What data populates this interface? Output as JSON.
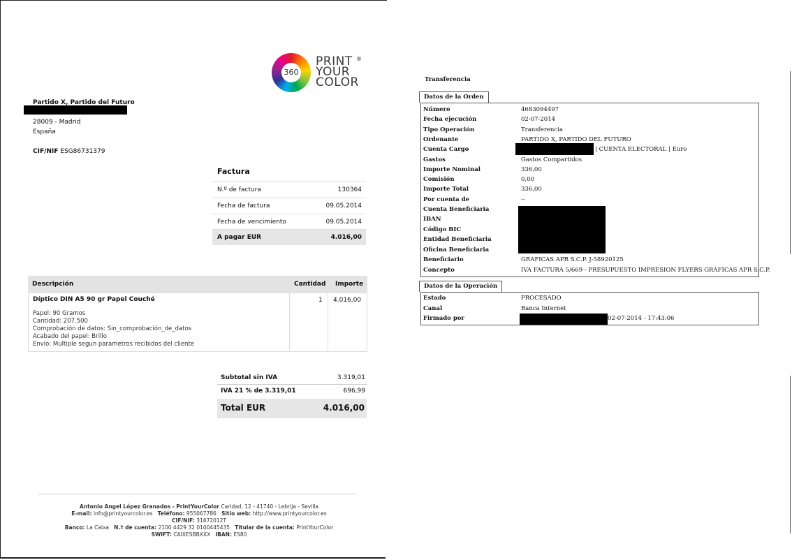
{
  "logo": {
    "number": "360",
    "line1": "PRINT",
    "line2": "YOUR",
    "line3": "COLOR",
    "reg": "®"
  },
  "client": {
    "name": "Partido X, Partido del Futuro",
    "postal": "28009 - Madrid",
    "country": "España",
    "cif_label": "CIF/NIF",
    "cif_value": "ESG86731379"
  },
  "invoice": {
    "title": "Factura",
    "rows": [
      {
        "label": "N.º de factura",
        "value": "130364"
      },
      {
        "label": "Fecha de factura",
        "value": "09.05.2014"
      },
      {
        "label": "Fecha de vencimiento",
        "value": "09.05.2014"
      }
    ],
    "pay_label": "A pagar EUR",
    "pay_value": "4.016,00"
  },
  "items": {
    "headers": {
      "description": "Descripción",
      "quantity": "Cantidad",
      "amount": "Importe"
    },
    "product": "Díptico DIN A5 90 gr Papel Couché",
    "quantity": "1",
    "amount": "4.016,00",
    "details": [
      "Papel: 90 Gramos",
      "Cantidad: 207.500",
      "Comprobación de datos: Sin_comprobación_de_datos",
      "Acabado del papel: Brillo",
      "Envío: Multiple segun parametros recibidos del cliente"
    ]
  },
  "totals": {
    "subtotal_label": "Subtotal sin IVA",
    "subtotal_value": "3.319,01",
    "iva_label": "IVA 21 % de 3.319,01",
    "iva_value": "696,99",
    "total_label": "Total EUR",
    "total_value": "4.016,00"
  },
  "footer": {
    "line1_bold": "Antonio Angel López Granados - PrintYourColor",
    "line1_rest": "Caridad, 12 - 41740 - Lebrija - Sevilla",
    "email_label": "E-mail:",
    "email": "info@printyourcolor.es",
    "phone_label": "Teléfono:",
    "phone": "955067786",
    "web_label": "Sitio web:",
    "web": "http://www.printyourcolor.es",
    "cif_label": "CIF/NIF:",
    "cif": "31672012T",
    "bank_label": "Banco:",
    "bank": "La Caixa",
    "account_label": "N.º de cuenta:",
    "account": "2100 4429 32 0100445435",
    "holder_label": "Titular de la cuenta:",
    "holder": "PrintYourColor",
    "swift_label": "SWIFT:",
    "swift": "CAIXESBBXXX",
    "iban_label": "IBAN:",
    "iban": "ES80"
  },
  "transfer": {
    "title": "Transferencia",
    "order_tab": "Datos de la Orden",
    "order_rows": [
      {
        "key": "Número",
        "value": "4683094497"
      },
      {
        "key": "Fecha ejecución",
        "value": "02-07-2014"
      },
      {
        "key": "Tipo Operación",
        "value": "Transferencia"
      },
      {
        "key": "Ordenante",
        "value": "PARTIDO X, PARTIDO DEL FUTURO"
      },
      {
        "key": "Cuenta Cargo",
        "value": "| CUENTA ELECTORAL | Euro"
      },
      {
        "key": "Gastos",
        "value": "Gastos Compartidos"
      },
      {
        "key": "Importe Nominal",
        "value": "336,00"
      },
      {
        "key": "Comisión",
        "value": "0,00"
      },
      {
        "key": "Importe Total",
        "value": "336,00"
      },
      {
        "key": "Por cuenta de",
        "value": "--"
      },
      {
        "key": "Cuenta Beneficiaria",
        "value": ""
      },
      {
        "key": "IBAN",
        "value": ""
      },
      {
        "key": "Código BIC",
        "value": ""
      },
      {
        "key": "Entidad Beneficiaria",
        "value": ""
      },
      {
        "key": "Oficina Beneficiaria",
        "value": ""
      },
      {
        "key": "Beneficiario",
        "value": "GRAFICAS APR S.C.P. J-58920125"
      },
      {
        "key": "Concepto",
        "value": "IVA FACTURA 5/669 - PRESUPUESTO IMPRESION FLYERS GRAFICAS APR S.C.P."
      }
    ],
    "op_tab": "Datos de la Operación",
    "op_rows": [
      {
        "key": "Estado",
        "value": "PROCESADO"
      },
      {
        "key": "Canal",
        "value": "Banca Internet"
      },
      {
        "key": "Firmado por",
        "value": "02-07-2014 - 17:43:06"
      }
    ]
  }
}
